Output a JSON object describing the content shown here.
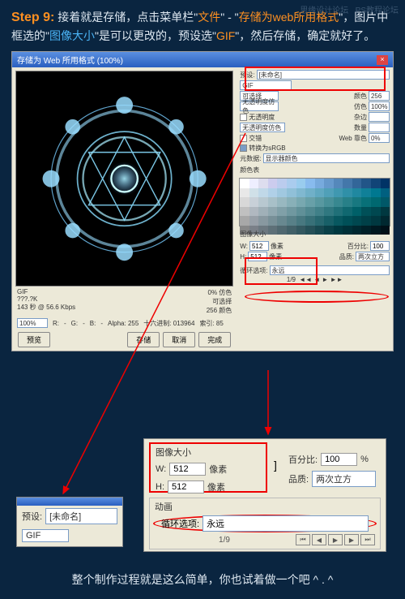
{
  "watermark1": "思缘设计论坛",
  "watermark2": "PS教程论坛",
  "step": {
    "label": "Step 9:",
    "t1": "接着就是存储，点击菜单栏\"",
    "file": "文件",
    "dash": "\" - \"",
    "save": "存储为web所用格式",
    "t2": "\"，图片中框选的\"",
    "imgsize": "图像大小",
    "t3": "\"是可以更改的，预设选\"",
    "gif": "GIF",
    "t4": "\"，然后存储，确定就好了。"
  },
  "title": "存储为 Web 所用格式 (100%)",
  "info": {
    "gif": "GIF",
    "size": "???.?K",
    "rate": "143 秒 @ 56.6 Kbps",
    "dither": "0% 仿色",
    "palette": "可选择",
    "colors": "256 颜色"
  },
  "zoom": "100%",
  "r": "R:",
  "g": "G:",
  "b": "B:",
  "alpha": "Alpha: 255",
  "hex": "十六进制: 013964",
  "idx": "索引: 85",
  "btns": {
    "preview": "预览",
    "save": "存储",
    "cancel": "取消",
    "done": "完成"
  },
  "ctrl": {
    "preset": "预设:",
    "unnamed": "[未命名]",
    "gif": "GIF",
    "colors": "颜色",
    "c256": "256",
    "selective": "可选择",
    "dither": "仿色",
    "d100": "100%",
    "noTrans": "无透明度",
    "matte": "杂边",
    "noDither": "无透明度仿色",
    "amount": "数量",
    "interlace": "交错",
    "websnap": "Web 靠色",
    "w0": "0%",
    "convert": "转换为sRGB",
    "metadata": "元数据:",
    "copyright": "显示器颜色",
    "colorTable": "颜色表",
    "imgSize": "图像大小",
    "w": "W:",
    "h": "H:",
    "px": "像素",
    "v512": "512",
    "pct": "百分比:",
    "p100": "100",
    "quality": "品质:",
    "bicubic": "两次立方",
    "loop": "循环选项:",
    "forever": "永远",
    "frame": "1/9"
  },
  "callout": {
    "preset": "预设:",
    "unnamed": "[未命名]",
    "gif": "GIF",
    "imgSize": "图像大小",
    "w": "W:",
    "h": "H:",
    "px": "像素",
    "v512": "512",
    "pct": "百分比:",
    "p100": "100",
    "pc": "%",
    "quality": "品质:",
    "bicubic": "两次立方",
    "anim": "动画",
    "loop": "循环选项:",
    "forever": "永远",
    "frame": "1/9"
  },
  "footer": "整个制作过程就是这么简单，你也试着做一个吧 ^ . ^",
  "swatches": [
    "#fff",
    "#eef",
    "#dde",
    "#cce",
    "#bce",
    "#ace",
    "#9ce",
    "#8be",
    "#7ad",
    "#69c",
    "#58b",
    "#47a",
    "#369",
    "#258",
    "#147",
    "#036",
    "#e8e8e8",
    "#d0e0e8",
    "#c0d8e8",
    "#b0d0e8",
    "#a0c8e0",
    "#90c0d8",
    "#80b8d0",
    "#70b0c8",
    "#60a8c0",
    "#50a0b8",
    "#4098b0",
    "#3090a8",
    "#2088a0",
    "#108098",
    "#007890",
    "#006080",
    "#d8d8d8",
    "#c8d0d8",
    "#b8c8d0",
    "#a8c0c8",
    "#98b8c0",
    "#88b0b8",
    "#78a8b0",
    "#68a0a8",
    "#5898a0",
    "#489098",
    "#388890",
    "#288088",
    "#187880",
    "#087078",
    "#006870",
    "#005868",
    "#c0c0c0",
    "#b0b8c0",
    "#a0b0b8",
    "#90a8b0",
    "#80a0a8",
    "#7098a0",
    "#609098",
    "#508890",
    "#408088",
    "#307880",
    "#207078",
    "#106870",
    "#006068",
    "#005058",
    "#004850",
    "#003840",
    "#a8a8a8",
    "#98a0a8",
    "#8898a0",
    "#789098",
    "#688890",
    "#588088",
    "#487880",
    "#387078",
    "#286870",
    "#186068",
    "#085860",
    "#005058",
    "#004850",
    "#004048",
    "#003840",
    "#002830",
    "#888",
    "#7a8088",
    "#6c7880",
    "#5e7078",
    "#506870",
    "#426068",
    "#345860",
    "#265058",
    "#184850",
    "#0a4048",
    "#003840",
    "#003038",
    "#002830",
    "#002028",
    "#001820",
    "#001018"
  ]
}
